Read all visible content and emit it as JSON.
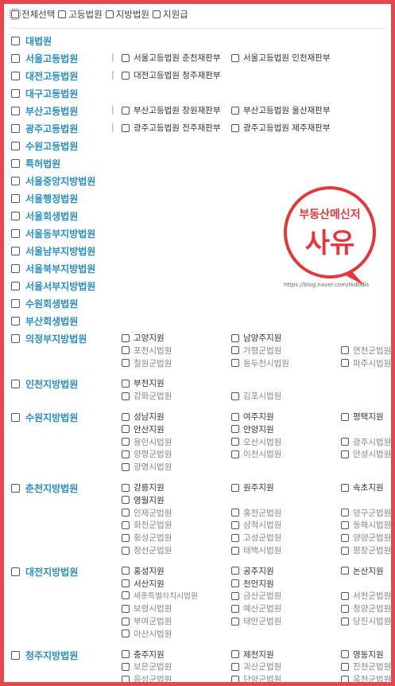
{
  "top_options": [
    "전체선택",
    "고등법원",
    "지방법원",
    "지원급"
  ],
  "stamp": {
    "title": "부동산메신저",
    "name": "사유",
    "url": "https://blog.naver.com/tkdbdls",
    "color": "#e03a3e"
  },
  "accent_color": "#2b8fc2",
  "courts": [
    {
      "label": "대법원",
      "subs": []
    },
    {
      "label": "서울고등법원",
      "divider": true,
      "subs": [
        [
          "서울고등법원 춘천재판부",
          "서울고등법원 인천재판부"
        ]
      ]
    },
    {
      "label": "대전고등법원",
      "divider": true,
      "subs": [
        [
          "대전고등법원 청주재판부"
        ]
      ]
    },
    {
      "label": "대구고등법원",
      "subs": []
    },
    {
      "label": "부산고등법원",
      "divider": true,
      "subs": [
        [
          "부산고등법원 창원재판부",
          "부산고등법원 울산재판부"
        ]
      ]
    },
    {
      "label": "광주고등법원",
      "divider": true,
      "subs": [
        [
          "광주고등법원 전주재판부",
          "광주고등법원 제주재판부"
        ]
      ]
    },
    {
      "label": "수원고등법원",
      "subs": []
    },
    {
      "label": "특허법원",
      "subs": []
    },
    {
      "label": "서울중앙지방법원",
      "subs": []
    },
    {
      "label": "서울행정법원",
      "subs": []
    },
    {
      "label": "서울회생법원",
      "subs": []
    },
    {
      "label": "서울동부지방법원",
      "subs": []
    },
    {
      "label": "서울남부지방법원",
      "subs": []
    },
    {
      "label": "서울북부지방법원",
      "subs": []
    },
    {
      "label": "서울서부지방법원",
      "subs": []
    },
    {
      "label": "수원회생법원",
      "subs": []
    },
    {
      "label": "부산회생법원",
      "subs": []
    },
    {
      "label": "의정부지방법원",
      "grid": true,
      "subs": [
        [
          "고양지원",
          "남양주지원",
          ""
        ],
        [
          "포천시법원",
          "가평군법원",
          "연천군법원"
        ],
        [
          "철원군법원",
          "동두천시법원",
          "파주시법원"
        ]
      ]
    },
    {
      "label": "인천지방법원",
      "grid": true,
      "subs": [
        [
          "부천지원",
          "",
          ""
        ],
        [
          "강화군법원",
          "김포시법원",
          ""
        ]
      ]
    },
    {
      "label": "수원지방법원",
      "grid": true,
      "subs": [
        [
          "성남지원",
          "여주지원",
          "평택지원"
        ],
        [
          "안산지원",
          "안양지원",
          ""
        ],
        [
          "용인시법원",
          "오산시법원",
          "광주시법원"
        ],
        [
          "양평군법원",
          "이천시법원",
          "안성시법원"
        ],
        [
          "광명시법원",
          "",
          ""
        ]
      ]
    },
    {
      "label": "춘천지방법원",
      "grid": true,
      "subs": [
        [
          "강릉지원",
          "원주지원",
          "속초지원"
        ],
        [
          "영월지원",
          "",
          ""
        ],
        [
          "인제군법원",
          "홍천군법원",
          "양구군법원"
        ],
        [
          "화천군법원",
          "삼척시법원",
          "동해시법원"
        ],
        [
          "횡성군법원",
          "고성군법원",
          "양양군법원"
        ],
        [
          "정선군법원",
          "태백시법원",
          "평창군법원"
        ]
      ]
    },
    {
      "label": "대전지방법원",
      "grid": true,
      "subs": [
        [
          "홍성지원",
          "공주지원",
          "논산지원"
        ],
        [
          "서산지원",
          "천안지원",
          ""
        ],
        [
          "세종특별자치시법원",
          "금산군법원",
          "서천군법원"
        ],
        [
          "보령시법원",
          "예산군법원",
          "청양군법원"
        ],
        [
          "부여군법원",
          "태안군법원",
          "당진시법원"
        ],
        [
          "아산시법원",
          "",
          ""
        ]
      ]
    },
    {
      "label": "청주지방법원",
      "grid": true,
      "subs": [
        [
          "충주지원",
          "제천지원",
          "영동지원"
        ],
        [
          "보은군법원",
          "괴산군법원",
          "진천군법원"
        ],
        [
          "음성군법원",
          "단양군법원",
          "옥천군법원"
        ]
      ]
    }
  ]
}
